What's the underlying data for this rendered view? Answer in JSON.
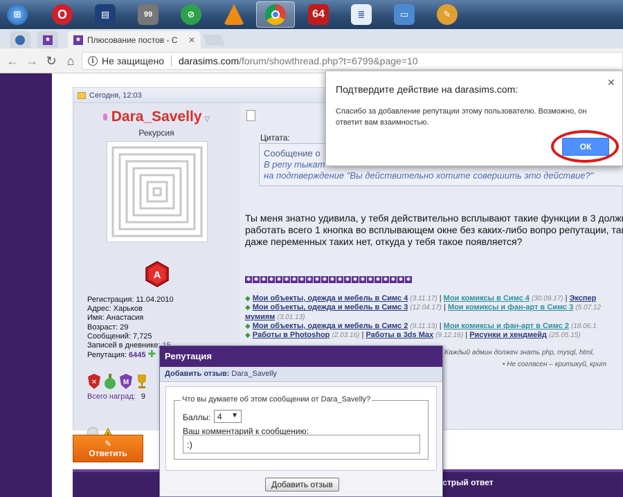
{
  "taskbar": {
    "items": [
      {
        "name": "start-orb",
        "color": "#3d8fd6"
      },
      {
        "name": "opera",
        "color": "#d0202a"
      },
      {
        "name": "save-floppy",
        "color": "#1f3f7a"
      },
      {
        "name": "monitor-99",
        "label": "99",
        "color": "#777777"
      },
      {
        "name": "green-clip",
        "color": "#2ea14b"
      },
      {
        "name": "vlc",
        "color": "#f08a10"
      },
      {
        "name": "chrome",
        "color": "#2f9b4b"
      },
      {
        "name": "aida64",
        "label": "64",
        "color": "#c21b1b"
      },
      {
        "name": "notepad",
        "color": "#3b6ab0"
      },
      {
        "name": "network-pc",
        "color": "#4b8ad0"
      },
      {
        "name": "paint",
        "color": "#e0a030"
      }
    ]
  },
  "browser": {
    "tab_title": "Плюсование постов - С",
    "insecure_label": "Не защищено",
    "url_host": "darasims.com",
    "url_rest": "/forum/showthread.php?t=6799&page=10"
  },
  "post": {
    "date": "Сегодня, 12:03",
    "username": "Dara_Savelly",
    "user_title": "Рекурсия",
    "rank_letter": "A",
    "stats": {
      "registration_label": "Регистрация:",
      "registration": "11.04.2010",
      "address_label": "Адрес:",
      "address": "Харьков",
      "name_label": "Имя:",
      "name": "Анастасия",
      "age_label": "Возраст:",
      "age": "29",
      "posts_label": "Сообщений:",
      "posts": "7,725",
      "diary_label": "Записей в дневнике:",
      "diary": "15",
      "rep_label": "Репутация:",
      "rep": "6445"
    },
    "awards_label": "Всего наград:",
    "awards_count": "9",
    "quote_label": "Цитата:",
    "quote_line1": "Сообщение о",
    "quote_line2": "В репу тыкат",
    "quote_line3": "на подтверждение \"Вы действительно хотите совершить это действие?\"",
    "message": "Ты меня знатно удивила, у тебя действительно всплывают такие функции в 3 должна работать всего 1 кнопка во всплывающем окне без каких-либо вопро репутации, там даже переменных таких нет, откуда у тебя такое появляется?",
    "signature": {
      "line1a": "Мои объекты, одежда и мебель в Симс 4",
      "line1a_date": "(3.11.17)",
      "line1b": "Мои комиксы в Симс 4",
      "line1b_date": "(30.09.17)",
      "line1c": "Экспер",
      "line2a": "Мои объекты, одежда и мебель в Симс 3",
      "line2a_date": "(12.04.17)",
      "line2b": "Мои комиксы и фан-арт в Симс 3",
      "line2b_date": "(5.07.12",
      "line3": "мумиям",
      "line3_date": "(3.01.13)",
      "line4a": "Мои объекты, одежда и мебель в Симс 2",
      "line4a_date": "(9.11.13)",
      "line4b": "Мои комиксы и фан-арт в Симс 2",
      "line4b_date": "(18.06.1",
      "line5a": "Работы в Photoshop",
      "line5a_date": "(2.03.16)",
      "line5b": "Работы в 3ds Max",
      "line5b_date": "(9.12.16)",
      "line5c": "Рисунки и хендмейд",
      "line5c_date": "(25.05.15)"
    },
    "bullet1": "Каждый админ должен знать php, mysql, html, ",
    "bullet2": "Не согласен – критикуй, крит"
  },
  "reply_button": "Ответить",
  "quick_reply_title": "ыстрый ответ",
  "reputation_popup": {
    "title": "Репутация",
    "subtitle_label": "Добавить отзыв:",
    "subtitle_user": "Dara_Savelly",
    "legend": "Что вы думаете об этом сообщении от Dara_Savelly?",
    "points_label": "Баллы:",
    "points_value": "4",
    "comment_label": "Ваш комментарий к сообщению:",
    "comment_value": ":)",
    "submit_label": "Добавить отзыв"
  },
  "dialog": {
    "title": "Подтвердите действие на darasims.com:",
    "text": "Спасибо за добавление репутации этому пользователю. Возможно, он ответит вам взаимностью.",
    "ok_label": "ОК",
    "highlight_color": "#e01818"
  }
}
